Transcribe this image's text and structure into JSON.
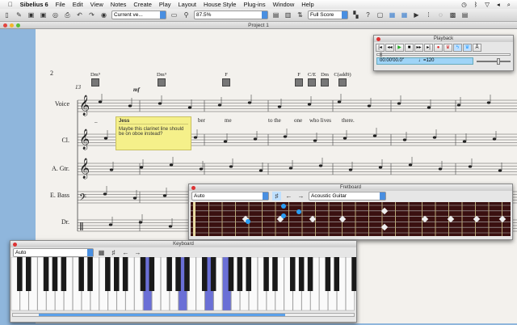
{
  "menubar": {
    "app": "Sibelius 6",
    "items": [
      "File",
      "Edit",
      "View",
      "Notes",
      "Create",
      "Play",
      "Layout",
      "House Style",
      "Plug-ins",
      "Window",
      "Help"
    ]
  },
  "toolbar": {
    "view_select": "Current ve...",
    "zoom": "87.5%",
    "score_select": "Full Score",
    "help": "?"
  },
  "window": {
    "title": "Project 1"
  },
  "score": {
    "page_number": "2",
    "bar_number": "13",
    "dynamic": "mf",
    "instruments": [
      "Voice",
      "Cl.",
      "A. Gtr.",
      "E. Bass",
      "Dr."
    ],
    "chords": [
      "Dm⁹",
      "Dm⁹",
      "F",
      "F",
      "C/E",
      "Dm",
      "C(add9)"
    ],
    "lyrics": [
      "_",
      "ber",
      "me",
      "to the",
      "one",
      "who lives",
      "there."
    ]
  },
  "comment": {
    "author": "Jess",
    "text": "Maybe this clarinet line should be on oboe instead?"
  },
  "playback": {
    "title": "Playback",
    "time": "00:00'00.0\"",
    "tempo": "♩=120",
    "position": 0.02,
    "volume": 0.6
  },
  "fretboard": {
    "title": "Fretboard",
    "mode": "Auto",
    "instrument": "Acoustic Guitar"
  },
  "keyboard": {
    "title": "Keyboard",
    "mode": "Auto",
    "highlighted_keys": [
      15,
      19,
      22,
      24
    ]
  },
  "colors": {
    "highlight": "#6a6fd6",
    "note_dot": "#2a9df4",
    "fretboard": "#3a1010"
  }
}
